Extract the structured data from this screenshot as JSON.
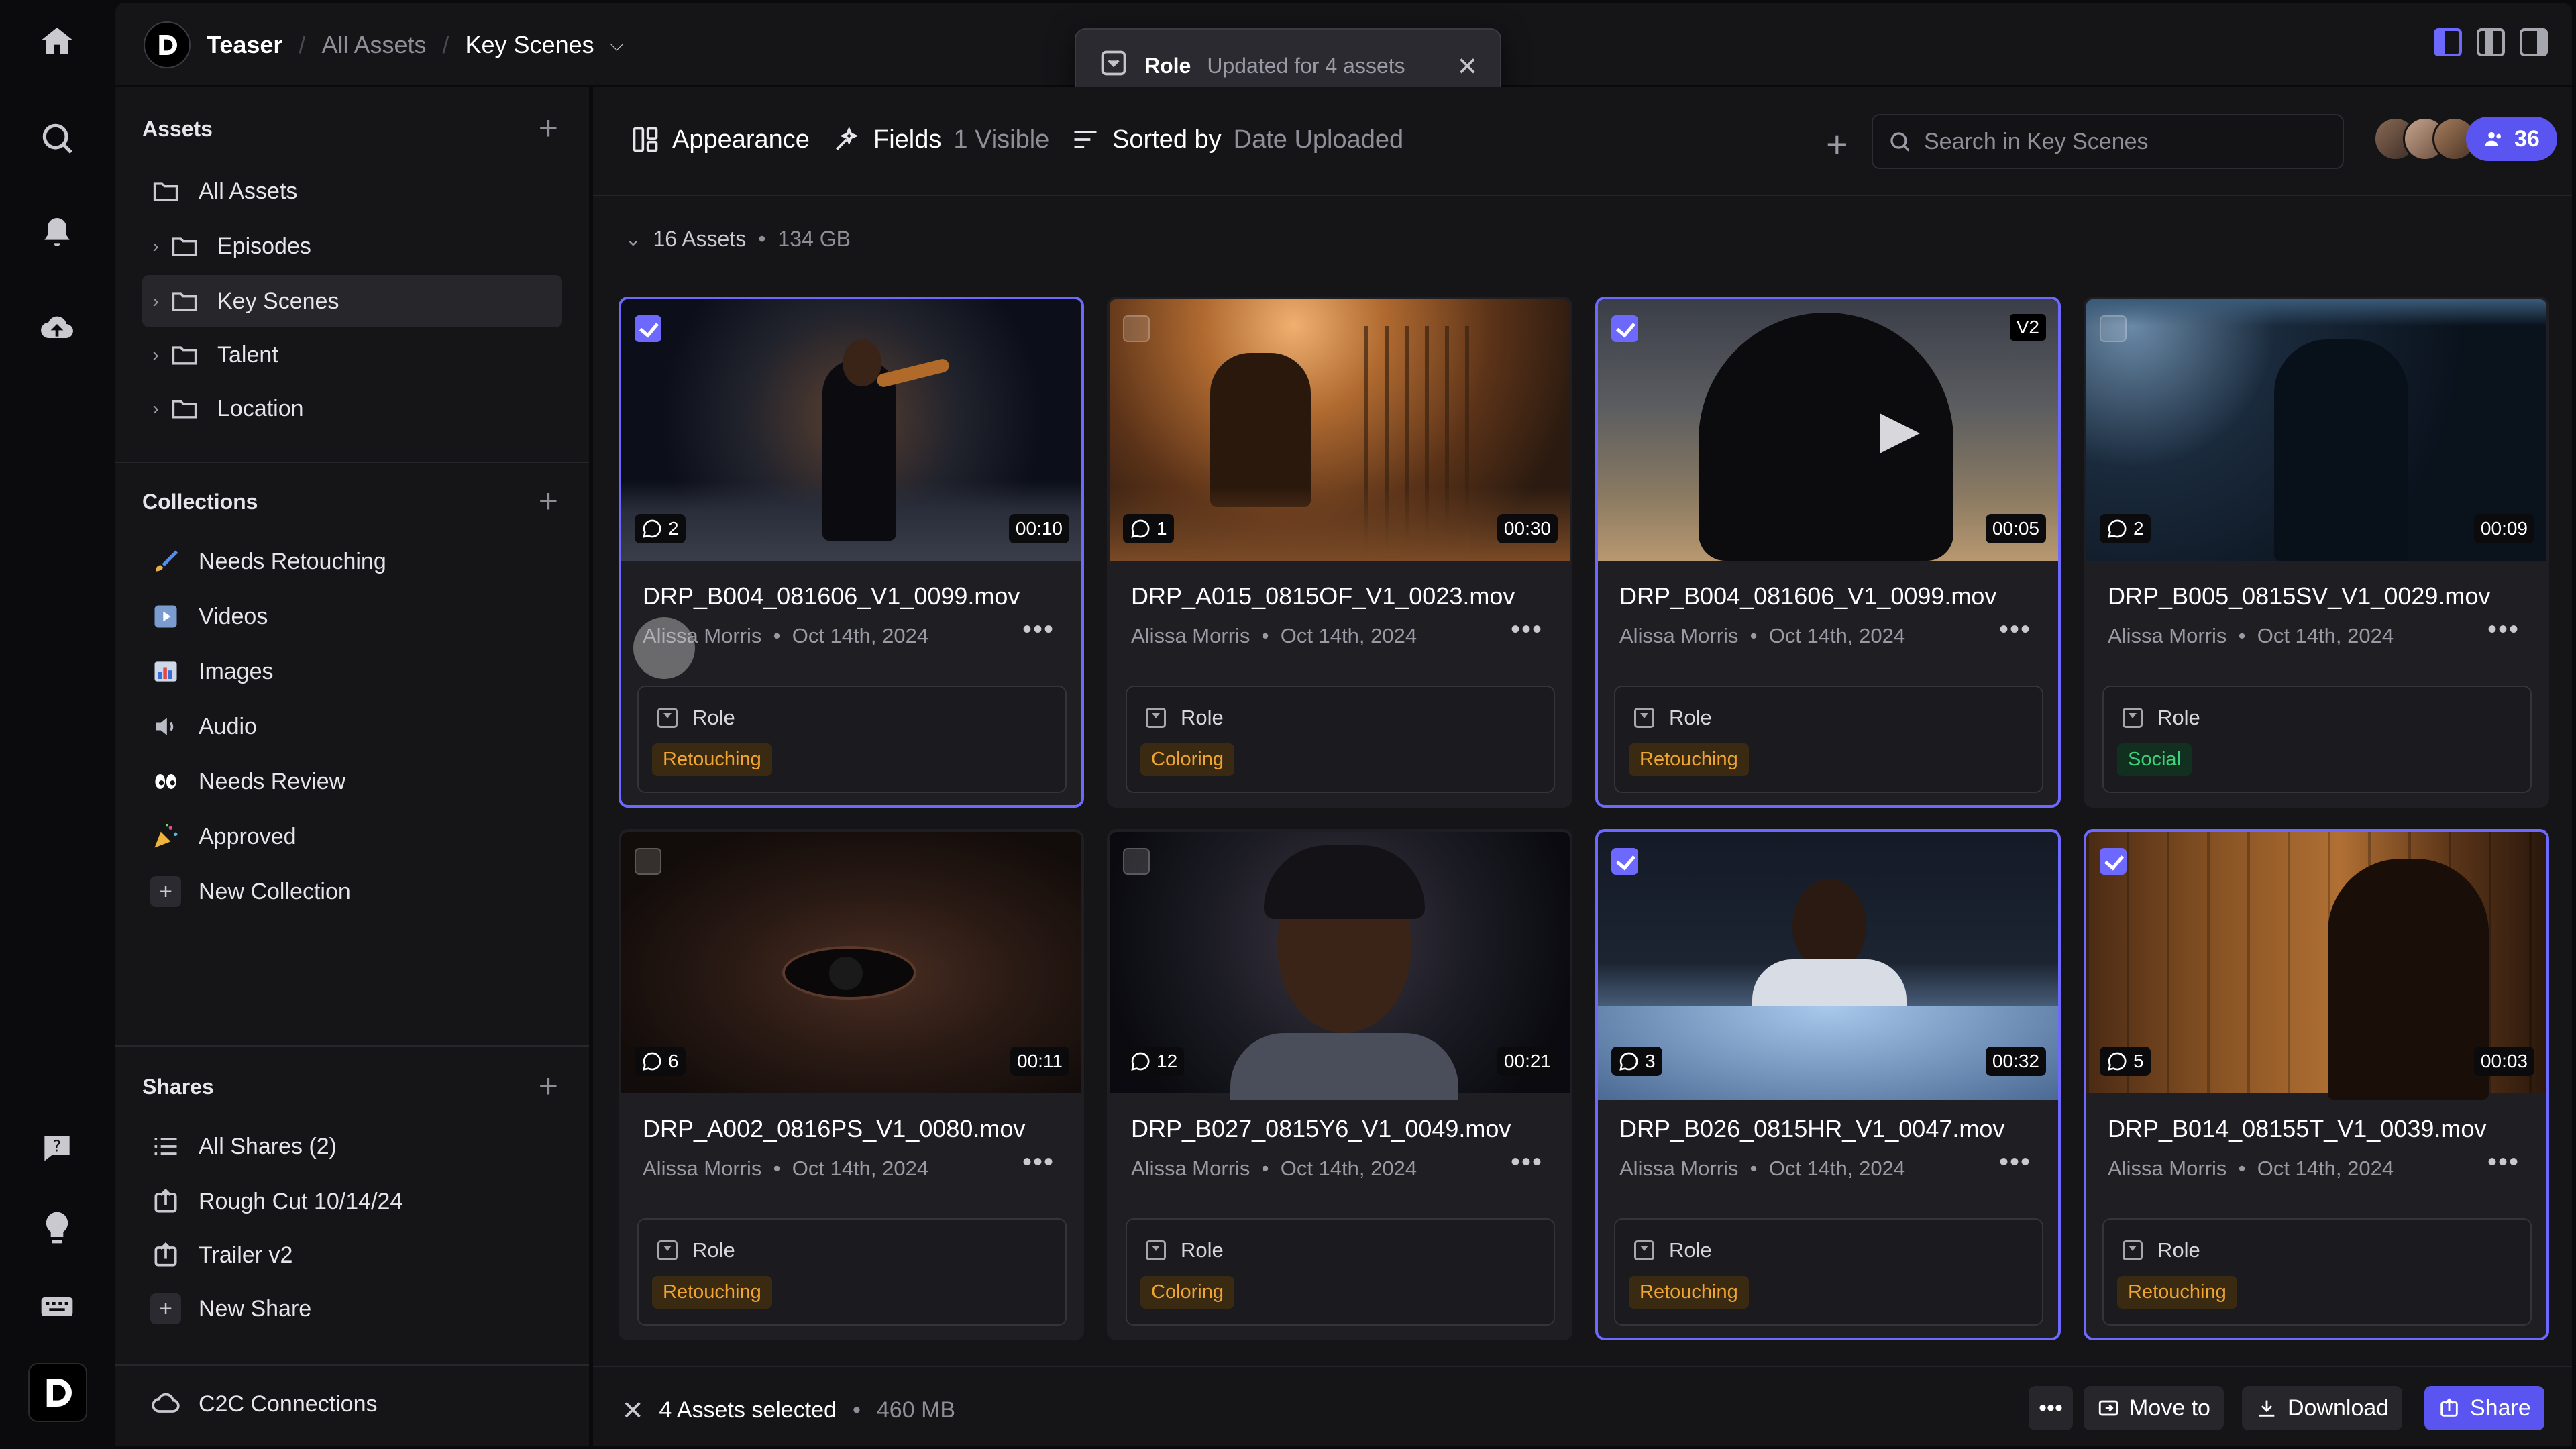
{
  "breadcrumb": {
    "project": "Teaser",
    "level1": "All Assets",
    "current": "Key Scenes"
  },
  "toast": {
    "field": "Role",
    "message": "Updated for 4 assets"
  },
  "sidebar": {
    "assets_title": "Assets",
    "assets": [
      {
        "label": "All Assets"
      },
      {
        "label": "Episodes"
      },
      {
        "label": "Key Scenes"
      },
      {
        "label": "Talent"
      },
      {
        "label": "Location"
      }
    ],
    "collections_title": "Collections",
    "collections": [
      {
        "label": "Needs Retouching",
        "icon": "brush-icon"
      },
      {
        "label": "Videos",
        "icon": "play-icon"
      },
      {
        "label": "Images",
        "icon": "image-icon"
      },
      {
        "label": "Audio",
        "icon": "speaker-icon"
      },
      {
        "label": "Needs Review",
        "icon": "eyes-icon"
      },
      {
        "label": "Approved",
        "icon": "party-icon"
      },
      {
        "label": "New Collection",
        "icon": "plus-icon"
      }
    ],
    "shares_title": "Shares",
    "shares": [
      {
        "label": "All Shares (2)"
      },
      {
        "label": "Rough Cut 10/14/24"
      },
      {
        "label": "Trailer v2"
      },
      {
        "label": "New Share"
      }
    ],
    "c2c": "C2C Connections"
  },
  "toolbar": {
    "appearance": "Appearance",
    "fields": "Fields",
    "fields_count": "1 Visible",
    "sorted_by": "Sorted by",
    "sort_value": "Date Uploaded",
    "search_placeholder": "Search in Key Scenes",
    "member_count": "36"
  },
  "summary": {
    "count": "16 Assets",
    "size": "134 GB"
  },
  "role_label": "Role",
  "cards": [
    {
      "name": "DRP_B004_081606_V1_0099.mov",
      "author": "Alissa Morris",
      "date": "Oct 14th, 2024",
      "comments": "2",
      "duration": "00:10",
      "tag": "Retouching",
      "selected": true
    },
    {
      "name": "DRP_A015_0815OF_V1_0023.mov",
      "author": "Alissa Morris",
      "date": "Oct 14th, 2024",
      "comments": "1",
      "duration": "00:30",
      "tag": "Coloring",
      "selected": false
    },
    {
      "name": "DRP_B004_081606_V1_0099.mov",
      "author": "Alissa Morris",
      "date": "Oct 14th, 2024",
      "comments": "",
      "duration": "00:05",
      "tag": "Retouching",
      "selected": true,
      "version": "V2"
    },
    {
      "name": "DRP_B005_0815SV_V1_0029.mov",
      "author": "Alissa Morris",
      "date": "Oct 14th, 2024",
      "comments": "2",
      "duration": "00:09",
      "tag": "Social",
      "selected": false
    },
    {
      "name": "DRP_A002_0816PS_V1_0080.mov",
      "author": "Alissa Morris",
      "date": "Oct 14th, 2024",
      "comments": "6",
      "duration": "00:11",
      "tag": "Retouching",
      "selected": false
    },
    {
      "name": "DRP_B027_0815Y6_V1_0049.mov",
      "author": "Alissa Morris",
      "date": "Oct 14th, 2024",
      "comments": "12",
      "duration": "00:21",
      "tag": "Coloring",
      "selected": false
    },
    {
      "name": "DRP_B026_0815HR_V1_0047.mov",
      "author": "Alissa Morris",
      "date": "Oct 14th, 2024",
      "comments": "3",
      "duration": "00:32",
      "tag": "Retouching",
      "selected": true
    },
    {
      "name": "DRP_B014_08155T_V1_0039.mov",
      "author": "Alissa Morris",
      "date": "Oct 14th, 2024",
      "comments": "5",
      "duration": "00:03",
      "tag": "Retouching",
      "selected": true
    }
  ],
  "footer": {
    "selected": "4 Assets selected",
    "size": "460 MB",
    "move": "Move to",
    "download": "Download",
    "share": "Share"
  },
  "colors": {
    "accent": "#6d69ff",
    "tag_orange": "#f0a531",
    "tag_green": "#3dd27a"
  }
}
